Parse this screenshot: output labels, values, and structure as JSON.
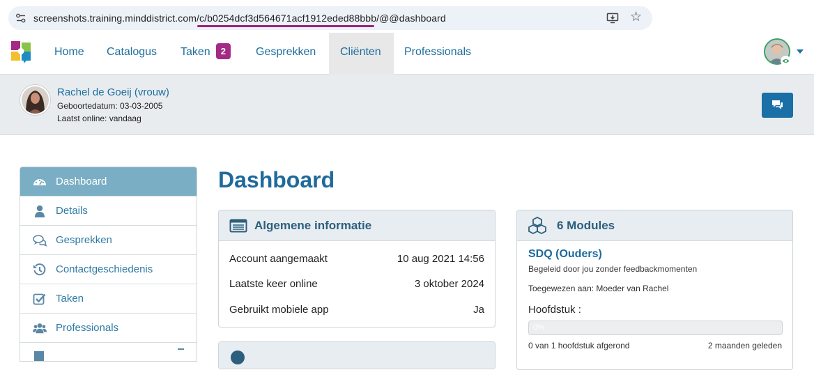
{
  "browser": {
    "url": "screenshots.training.minddistrict.com/c/b0254dcf3d564671acf1912eded88bbb/@@dashboard"
  },
  "nav": {
    "items": [
      {
        "label": "Home"
      },
      {
        "label": "Catalogus"
      },
      {
        "label": "Taken",
        "badge": "2"
      },
      {
        "label": "Gesprekken"
      },
      {
        "label": "Cliënten",
        "active": true
      },
      {
        "label": "Professionals"
      }
    ]
  },
  "client": {
    "name": "Rachel de Goeij (vrouw)",
    "birthdate": "Geboortedatum: 03-03-2005",
    "last_online": "Laatst online: vandaag"
  },
  "sidebar": {
    "items": [
      {
        "label": "Dashboard",
        "icon": "dashboard-icon",
        "active": true
      },
      {
        "label": "Details",
        "icon": "user-icon"
      },
      {
        "label": "Gesprekken",
        "icon": "chat-bubbles-icon"
      },
      {
        "label": "Contactgeschiedenis",
        "icon": "history-icon"
      },
      {
        "label": "Taken",
        "icon": "checkbox-icon"
      },
      {
        "label": "Professionals",
        "icon": "users-icon"
      }
    ]
  },
  "main": {
    "title": "Dashboard",
    "info_panel": {
      "title": "Algemene informatie",
      "rows": [
        {
          "label": "Account aangemaakt",
          "value": "10 aug 2021 14:56"
        },
        {
          "label": "Laatste keer online",
          "value": "3 oktober 2024"
        },
        {
          "label": "Gebruikt mobiele app",
          "value": "Ja"
        }
      ]
    },
    "modules_panel": {
      "title": "6 Modules",
      "module": {
        "name": "SDQ (Ouders)",
        "description": "Begeleid door jou zonder feedbackmomenten",
        "assigned": "Toegewezen aan: Moeder van Rachel",
        "chapter_label": "Hoofdstuk :",
        "progress": 0,
        "progress_text": "0%",
        "completed": "0 van 1 hoofdstuk afgerond",
        "when": "2 maanden geleden"
      }
    }
  },
  "colors": {
    "primary": "#1e6a9b",
    "badge": "#a32a85",
    "sidebar_active": "#7aaec4"
  }
}
